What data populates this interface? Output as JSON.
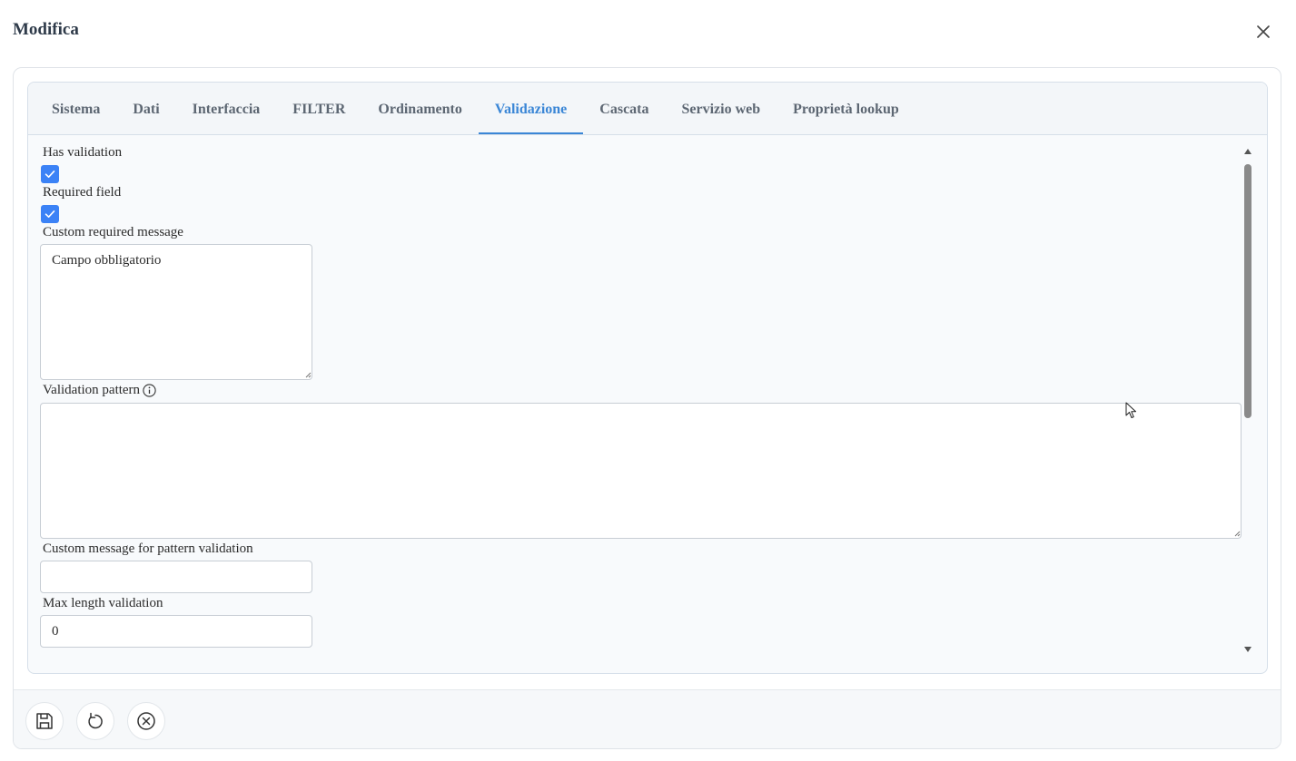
{
  "dialog": {
    "title": "Modifica"
  },
  "tabs": [
    {
      "label": "Sistema"
    },
    {
      "label": "Dati"
    },
    {
      "label": "Interfaccia"
    },
    {
      "label": "FILTER"
    },
    {
      "label": "Ordinamento"
    },
    {
      "label": "Validazione",
      "active": true
    },
    {
      "label": "Cascata"
    },
    {
      "label": "Servizio web"
    },
    {
      "label": "Proprietà lookup"
    }
  ],
  "form": {
    "has_validation": {
      "label": "Has validation",
      "checked": true
    },
    "required_field": {
      "label": "Required field",
      "checked": true
    },
    "custom_required_message": {
      "label": "Custom required message",
      "value": "Campo obbligatorio"
    },
    "validation_pattern": {
      "label": "Validation pattern",
      "value": ""
    },
    "pattern_message": {
      "label": "Custom message for pattern validation",
      "value": ""
    },
    "max_length": {
      "label": "Max length validation",
      "value": "0"
    }
  },
  "icons": {
    "close": "close-icon",
    "info": "info-icon",
    "save": "save-icon",
    "reset": "undo-icon",
    "cancel": "cancel-icon"
  },
  "colors": {
    "accent": "#3a86d6",
    "checkbox": "#3b82f6",
    "title": "#2f3b4a"
  }
}
